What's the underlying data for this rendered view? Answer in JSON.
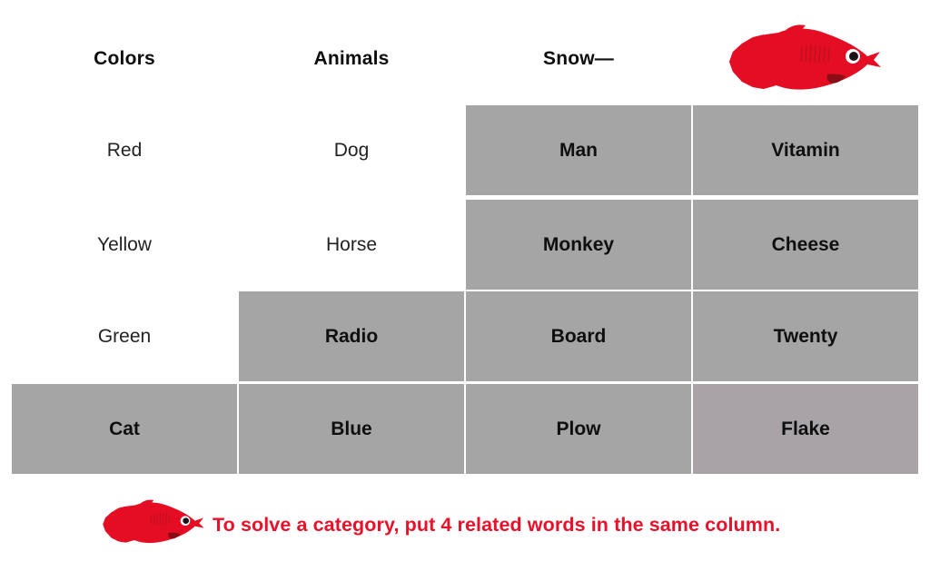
{
  "page": {
    "background": "#ffffff",
    "accent_red": "#e8112a",
    "cell_gray": "#a5a5a5",
    "cell_gray_tinted": "#a8a3a6"
  },
  "headers": [
    {
      "label": "Colors"
    },
    {
      "label": "Animals"
    },
    {
      "label": "Snow—"
    },
    {
      "label": ""
    }
  ],
  "grid": {
    "rows": [
      [
        {
          "text": "Red",
          "filled": false
        },
        {
          "text": "Dog",
          "filled": false
        },
        {
          "text": "Man",
          "filled": true
        },
        {
          "text": "Vitamin",
          "filled": true
        }
      ],
      [
        {
          "text": "Yellow",
          "filled": false
        },
        {
          "text": "Horse",
          "filled": false
        },
        {
          "text": "Monkey",
          "filled": true
        },
        {
          "text": "Cheese",
          "filled": true
        }
      ],
      [
        {
          "text": "Green",
          "filled": false
        },
        {
          "text": "Radio",
          "filled": true
        },
        {
          "text": "Board",
          "filled": true
        },
        {
          "text": "Twenty",
          "filled": true
        }
      ],
      [
        {
          "text": "Cat",
          "filled": true
        },
        {
          "text": "Blue",
          "filled": true
        },
        {
          "text": "Plow",
          "filled": true
        },
        {
          "text": "Flake",
          "filled": true,
          "tinted": true
        }
      ]
    ]
  },
  "caption": {
    "text": "To solve a category, put 4 related words in the same column."
  },
  "icons": {
    "fish_top": "red-herring-fish-icon",
    "fish_bottom": "red-herring-fish-icon"
  }
}
